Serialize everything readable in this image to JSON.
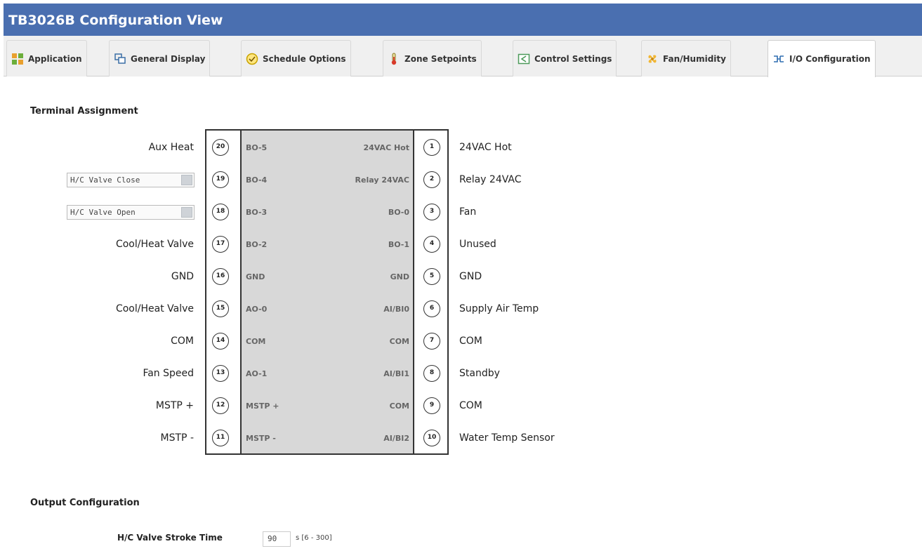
{
  "window": {
    "title": "TB3026B Configuration View"
  },
  "tabs": [
    {
      "label": "Application",
      "icon": "application-icon"
    },
    {
      "label": "General Display",
      "icon": "display-icon"
    },
    {
      "label": "Schedule Options",
      "icon": "schedule-icon"
    },
    {
      "label": "Zone Setpoints",
      "icon": "thermometer-icon"
    },
    {
      "label": "Control Settings",
      "icon": "control-icon"
    },
    {
      "label": "Fan/Humidity",
      "icon": "fan-icon"
    },
    {
      "label": "I/O Configuration",
      "icon": "io-icon",
      "active": true
    }
  ],
  "terminal": {
    "title": "Terminal Assignment",
    "rows": [
      {
        "left_label": "Aux Heat",
        "left_num": "20",
        "left_term": "BO-5",
        "right_term": "24VAC Hot",
        "right_num": "1",
        "right_label": "24VAC Hot"
      },
      {
        "left_select": "H/C Valve Close",
        "left_num": "19",
        "left_term": "BO-4",
        "right_term": "Relay 24VAC",
        "right_num": "2",
        "right_label": "Relay 24VAC"
      },
      {
        "left_select": "H/C Valve Open",
        "left_num": "18",
        "left_term": "BO-3",
        "right_term": "BO-0",
        "right_num": "3",
        "right_label": "Fan"
      },
      {
        "left_label": "Cool/Heat Valve",
        "left_num": "17",
        "left_term": "BO-2",
        "right_term": "BO-1",
        "right_num": "4",
        "right_label": "Unused"
      },
      {
        "left_label": "GND",
        "left_num": "16",
        "left_term": "GND",
        "right_term": "GND",
        "right_num": "5",
        "right_label": "GND"
      },
      {
        "left_label": "Cool/Heat Valve",
        "left_num": "15",
        "left_term": "AO-0",
        "right_term": "AI/BI0",
        "right_num": "6",
        "right_label": "Supply Air Temp"
      },
      {
        "left_label": "COM",
        "left_num": "14",
        "left_term": "COM",
        "right_term": "COM",
        "right_num": "7",
        "right_label": "COM"
      },
      {
        "left_label": "Fan Speed",
        "left_num": "13",
        "left_term": "AO-1",
        "right_term": "AI/BI1",
        "right_num": "8",
        "right_label": "Standby"
      },
      {
        "left_label": "MSTP +",
        "left_num": "12",
        "left_term": "MSTP +",
        "right_term": "COM",
        "right_num": "9",
        "right_label": "COM"
      },
      {
        "left_label": "MSTP -",
        "left_num": "11",
        "left_term": "MSTP -",
        "right_term": "AI/BI2",
        "right_num": "10",
        "right_label": "Water Temp Sensor"
      }
    ]
  },
  "output": {
    "title": "Output Configuration",
    "stroke_label": "H/C Valve Stroke Time",
    "stroke_value": "90",
    "stroke_range": "s [6 - 300]"
  },
  "colors": {
    "titlebar": "#4a6fb0",
    "terminal_fill": "#d8d8d8"
  }
}
